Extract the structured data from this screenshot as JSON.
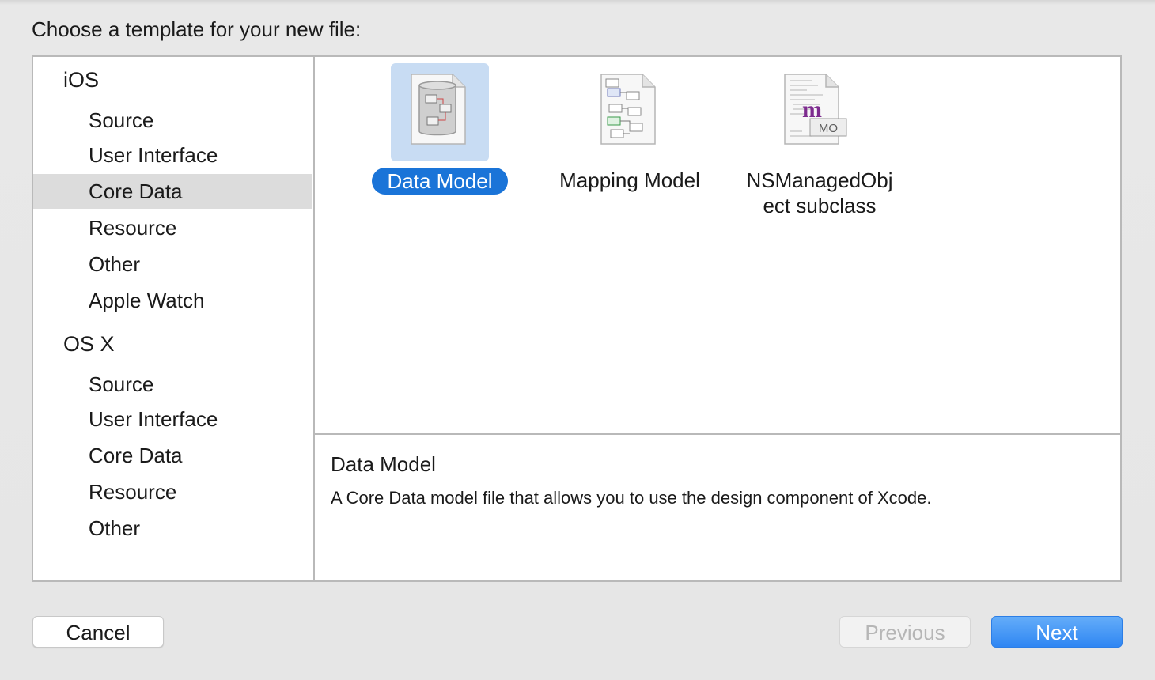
{
  "dialog": {
    "prompt": "Choose a template for your new file:"
  },
  "sidebar": {
    "groups": [
      {
        "title": "iOS",
        "items": [
          "Source",
          "User Interface",
          "Core Data",
          "Resource",
          "Other",
          "Apple Watch"
        ]
      },
      {
        "title": "OS X",
        "items": [
          "Source",
          "User Interface",
          "Core Data",
          "Resource",
          "Other"
        ]
      }
    ],
    "selected_item": "Core Data"
  },
  "templates": [
    {
      "label": "Data Model",
      "icon": "data-model-icon",
      "selected": true
    },
    {
      "label": "Mapping Model",
      "icon": "mapping-model-icon",
      "selected": false
    },
    {
      "label_line1": "NSManagedObj",
      "label_line2": "ect subclass",
      "icon": "nsmanagedobject-icon",
      "badge": "MO",
      "glyph": "m",
      "selected": false
    }
  ],
  "description": {
    "title": "Data Model",
    "text": "A Core Data model file that allows you to use the design component of Xcode."
  },
  "buttons": {
    "cancel": "Cancel",
    "previous": "Previous",
    "next": "Next"
  },
  "colors": {
    "accent": "#1a74d8",
    "selection_bg": "#c8dcf3",
    "next_button": "#2f86f3"
  }
}
